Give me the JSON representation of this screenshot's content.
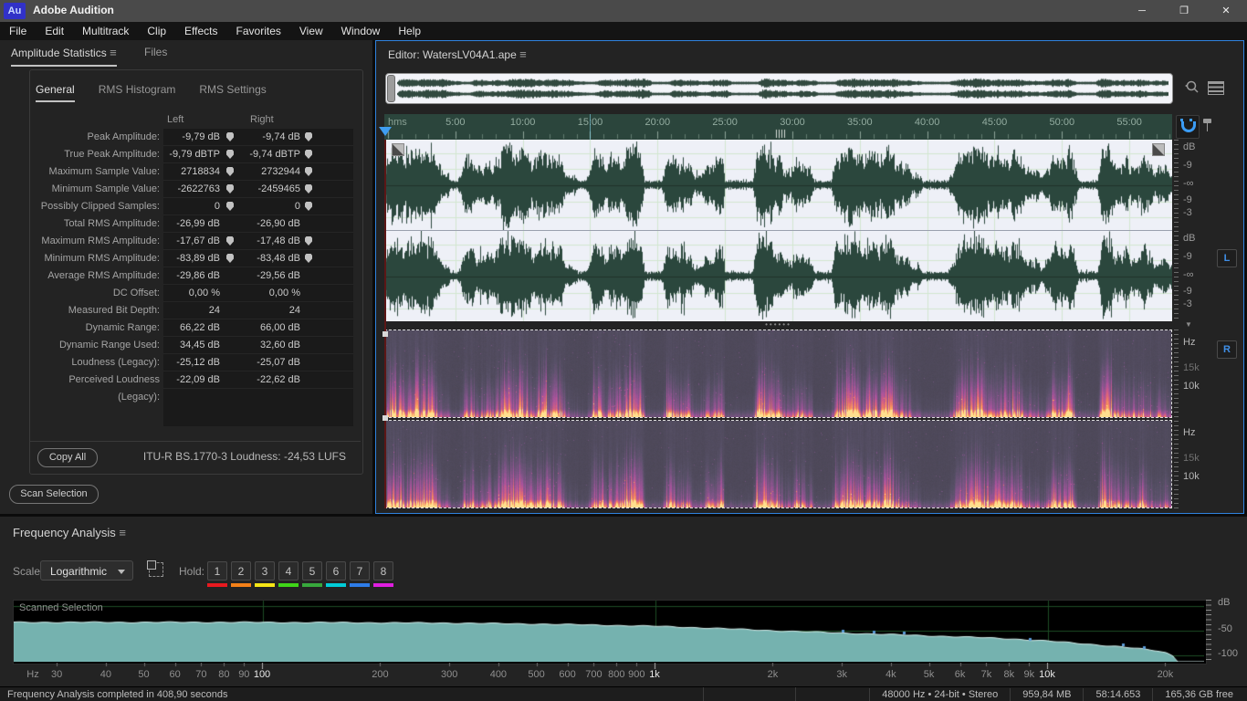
{
  "window": {
    "title": "Adobe Audition",
    "logo_text": "Au",
    "controls": [
      {
        "name": "minimize",
        "glyph": "─"
      },
      {
        "name": "restore",
        "glyph": "❐"
      },
      {
        "name": "close",
        "glyph": "✕"
      }
    ]
  },
  "icons": {
    "panel_menu": "≡"
  },
  "menubar": {
    "items": [
      "File",
      "Edit",
      "Multitrack",
      "Clip",
      "Effects",
      "Favorites",
      "View",
      "Window",
      "Help"
    ]
  },
  "amplitude_panel": {
    "tab_active": "Amplitude Statistics",
    "tab_files": "Files",
    "subtabs": [
      {
        "label": "General",
        "active": true
      },
      {
        "label": "RMS Histogram",
        "active": false
      },
      {
        "label": "RMS Settings",
        "active": false
      }
    ],
    "col_left": "Left",
    "col_right": "Right",
    "rows": [
      {
        "label": "Peak Amplitude:",
        "left": "-9,79 dB",
        "right": "-9,74 dB",
        "pin": true
      },
      {
        "label": "True Peak Amplitude:",
        "left": "-9,79 dBTP",
        "right": "-9,74 dBTP",
        "pin": true
      },
      {
        "label": "Maximum Sample Value:",
        "left": "2718834",
        "right": "2732944",
        "pin": true
      },
      {
        "label": "Minimum Sample Value:",
        "left": "-2622763",
        "right": "-2459465",
        "pin": true
      },
      {
        "label": "Possibly Clipped Samples:",
        "left": "0",
        "right": "0",
        "pin": true
      },
      {
        "label": "Total RMS Amplitude:",
        "left": "-26,99 dB",
        "right": "-26,90 dB",
        "pin": false
      },
      {
        "label": "Maximum RMS Amplitude:",
        "left": "-17,67 dB",
        "right": "-17,48 dB",
        "pin": true
      },
      {
        "label": "Minimum RMS Amplitude:",
        "left": "-83,89 dB",
        "right": "-83,48 dB",
        "pin": true
      },
      {
        "label": "Average RMS Amplitude:",
        "left": "-29,86 dB",
        "right": "-29,56 dB",
        "pin": false
      },
      {
        "label": "DC Offset:",
        "left": "0,00 %",
        "right": "0,00 %",
        "pin": false
      },
      {
        "label": "Measured Bit Depth:",
        "left": "24",
        "right": "24",
        "pin": false
      },
      {
        "label": "Dynamic Range:",
        "left": "66,22 dB",
        "right": "66,00 dB",
        "pin": false
      },
      {
        "label": "Dynamic Range Used:",
        "left": "34,45 dB",
        "right": "32,60 dB",
        "pin": false
      },
      {
        "label": "Loudness (Legacy):",
        "left": "-25,12 dB",
        "right": "-25,07 dB",
        "pin": false
      },
      {
        "label": "Perceived Loudness (Legacy):",
        "left": "-22,09 dB",
        "right": "-22,62 dB",
        "pin": false
      }
    ],
    "copy_all_label": "Copy All",
    "itu_label": "ITU-R BS.1770-3 Loudness:",
    "itu_value": "-24,53 LUFS",
    "scan_selection_label": "Scan Selection"
  },
  "editor": {
    "title": "Editor: WatersLV04A1.ape",
    "ruler_unit": "hms",
    "time_labels": [
      "5:00",
      "10:00",
      "15:00",
      "20:00",
      "25:00",
      "30:00",
      "35:00",
      "40:00",
      "45:00",
      "50:00",
      "55:00"
    ],
    "wave_db_labels": [
      "dB",
      "-9",
      "-∞",
      "-9",
      "-3"
    ],
    "left_button": "L",
    "right_button": "R",
    "spec_freq_labels": [
      "Hz",
      "15k",
      "10k"
    ],
    "waveform_quiet_regions": [
      [
        0.083,
        0.093
      ],
      [
        0.245,
        0.256
      ],
      [
        0.33,
        0.352
      ],
      [
        0.432,
        0.468
      ],
      [
        0.545,
        0.567
      ],
      [
        0.682,
        0.716
      ],
      [
        0.88,
        0.906
      ]
    ]
  },
  "frequency_panel": {
    "title": "Frequency Analysis",
    "scale_label": "Scale:",
    "scale_value": "Logarithmic",
    "hold_label": "Hold:",
    "hold_buttons": [
      {
        "label": "1",
        "color": "#e8191f"
      },
      {
        "label": "2",
        "color": "#f48018"
      },
      {
        "label": "3",
        "color": "#f5e515"
      },
      {
        "label": "4",
        "color": "#3fd618"
      },
      {
        "label": "5",
        "color": "#37a83c"
      },
      {
        "label": "6",
        "color": "#00ccd8"
      },
      {
        "label": "7",
        "color": "#2e7ce8"
      },
      {
        "label": "8",
        "color": "#e01ee0"
      }
    ],
    "plot": {
      "overlay_label": "Scanned Selection",
      "hz_label": "Hz",
      "db_axis_labels": [
        "dB",
        "-50",
        "-100"
      ],
      "freq_ticks": [
        {
          "f": 30,
          "label": "30",
          "strong": false
        },
        {
          "f": 40,
          "label": "40",
          "strong": false
        },
        {
          "f": 50,
          "label": "50",
          "strong": false
        },
        {
          "f": 60,
          "label": "60",
          "strong": false
        },
        {
          "f": 70,
          "label": "70",
          "strong": false
        },
        {
          "f": 80,
          "label": "80",
          "strong": false
        },
        {
          "f": 90,
          "label": "90",
          "strong": false
        },
        {
          "f": 100,
          "label": "100",
          "strong": true
        },
        {
          "f": 200,
          "label": "200",
          "strong": false
        },
        {
          "f": 300,
          "label": "300",
          "strong": false
        },
        {
          "f": 400,
          "label": "400",
          "strong": false
        },
        {
          "f": 500,
          "label": "500",
          "strong": false
        },
        {
          "f": 600,
          "label": "600",
          "strong": false
        },
        {
          "f": 700,
          "label": "700",
          "strong": false
        },
        {
          "f": 800,
          "label": "800",
          "strong": false
        },
        {
          "f": 900,
          "label": "900",
          "strong": false
        },
        {
          "f": 1000,
          "label": "1k",
          "strong": true
        },
        {
          "f": 2000,
          "label": "2k",
          "strong": false
        },
        {
          "f": 3000,
          "label": "3k",
          "strong": false
        },
        {
          "f": 4000,
          "label": "4k",
          "strong": false
        },
        {
          "f": 5000,
          "label": "5k",
          "strong": false
        },
        {
          "f": 6000,
          "label": "6k",
          "strong": false
        },
        {
          "f": 7000,
          "label": "7k",
          "strong": false
        },
        {
          "f": 8000,
          "label": "8k",
          "strong": false
        },
        {
          "f": 9000,
          "label": "9k",
          "strong": false
        },
        {
          "f": 10000,
          "label": "10k",
          "strong": true
        },
        {
          "f": 20000,
          "label": "20k",
          "strong": false
        }
      ],
      "curve_db_by_freq": [
        [
          23,
          -33
        ],
        [
          40,
          -33
        ],
        [
          80,
          -33
        ],
        [
          150,
          -33.5
        ],
        [
          300,
          -34.5
        ],
        [
          500,
          -36.5
        ],
        [
          700,
          -38.5
        ],
        [
          1000,
          -41
        ],
        [
          1400,
          -45
        ],
        [
          2000,
          -50
        ],
        [
          2800,
          -54
        ],
        [
          4000,
          -58
        ],
        [
          5000,
          -60.5
        ],
        [
          6500,
          -63.5
        ],
        [
          8000,
          -66.5
        ],
        [
          10000,
          -71
        ],
        [
          12500,
          -77
        ],
        [
          15000,
          -82
        ],
        [
          17000,
          -86.5
        ],
        [
          19000,
          -91
        ],
        [
          20000,
          -95
        ],
        [
          20800,
          -101
        ],
        [
          21300,
          -110
        ],
        [
          21600,
          -117
        ]
      ],
      "peak_markers": [
        [
          3000,
          -52
        ],
        [
          3600,
          -53
        ],
        [
          4300,
          -55
        ],
        [
          9000,
          -68
        ],
        [
          15500,
          -80
        ],
        [
          17500,
          -85
        ]
      ]
    }
  },
  "status_bar": {
    "message": "Frequency Analysis completed in 408,90 seconds",
    "segments": [
      "48000 Hz • 24-bit • Stereo",
      "959,84 MB",
      "58:14.653",
      "165,36 GB free"
    ]
  },
  "colors": {
    "editor_border": "#2f82de",
    "playhead": "#3f9df0",
    "waveform": "#2b473d",
    "waveform_bg": "#eef0f7",
    "ruler_bg": "#2b453c",
    "freq_fill": "#75b2af",
    "freq_edge": "#d2efec",
    "grid_green": "#1d4d26"
  }
}
